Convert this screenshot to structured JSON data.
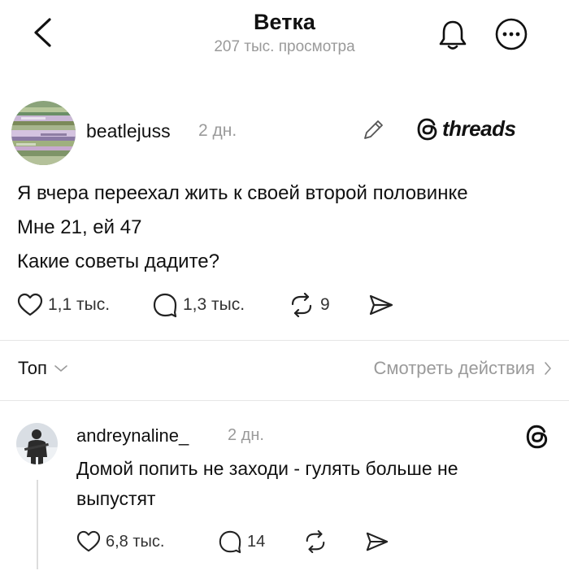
{
  "header": {
    "title": "Ветка",
    "subtitle": "207 тыс. просмотра"
  },
  "post": {
    "username": "beatlejuss",
    "time": "2 дн.",
    "brand": "threads",
    "lines": [
      "Я вчера переехал жить к своей второй половинке",
      "Мне 21, ей 47",
      "Какие советы дадите?"
    ],
    "likes": "1,1 тыс.",
    "replies": "1,3 тыс.",
    "reposts": "9"
  },
  "controls": {
    "sort_label": "Топ",
    "view_activity": "Смотреть действия"
  },
  "reply": {
    "username": "andreynaline_",
    "time": "2 дн.",
    "lines": [
      "Домой попить не заходи - гулять больше не",
      "выпустят"
    ],
    "likes": "6,8 тыс.",
    "replies": "14"
  },
  "icons": {
    "back": "chevron-left-icon",
    "bell": "bell-icon",
    "more": "more-horizontal-icon",
    "edit": "pencil-icon",
    "like": "heart-icon",
    "comment": "comment-bubble-icon",
    "repost": "repost-icon",
    "share": "share-icon",
    "threads": "threads-logo-icon"
  }
}
